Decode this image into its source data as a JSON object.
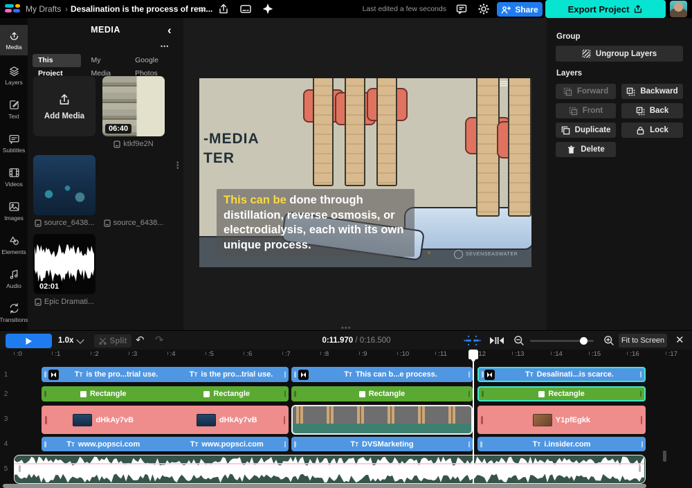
{
  "topbar": {
    "breadcrumb": "My Drafts",
    "crumb_separator": "›",
    "title": "Desalination is the process of rem...",
    "last_edited": "Last edited a few seconds ago",
    "share_label": "Share",
    "export_label": "Export Project"
  },
  "sidebar": {
    "items": [
      {
        "label": "Media"
      },
      {
        "label": "Layers"
      },
      {
        "label": "Text"
      },
      {
        "label": "Subtitles"
      },
      {
        "label": "Videos"
      },
      {
        "label": "Images"
      },
      {
        "label": "Elements"
      },
      {
        "label": "Audio"
      },
      {
        "label": "Transitions"
      }
    ]
  },
  "media_panel": {
    "title": "MEDIA",
    "menu_dots": "•••",
    "tabs": [
      {
        "label": "This Project"
      },
      {
        "label": "My Media"
      },
      {
        "label": "Google Photos"
      }
    ],
    "add_media_label": "Add Media",
    "items": [
      {
        "name": "ktkf9e2N",
        "duration": "06:40"
      },
      {
        "name": "source_6438..."
      },
      {
        "name": "source_6438..."
      },
      {
        "name": "Epic Dramati...",
        "duration": "02:01"
      }
    ]
  },
  "preview": {
    "caption_highlight": "This can be",
    "caption_rest": " done through distillation, reverse osmosis, or electrodialysis, each with its own unique process.",
    "scene_text_line1": "-MEDIA",
    "scene_text_line2": "TER",
    "watermark": "SEVENSEASWATER"
  },
  "right_panel": {
    "group_label": "Group",
    "ungroup_label": "Ungroup Layers",
    "layers_label": "Layers",
    "forward": "Forward",
    "backward": "Backward",
    "front": "Front",
    "back": "Back",
    "duplicate": "Duplicate",
    "lock": "Lock",
    "delete": "Delete"
  },
  "transport": {
    "speed": "1.0x",
    "split_label": "Split",
    "time_current": "0:11.970",
    "time_separator": " / ",
    "time_total": "0:16.500",
    "fit_label": "Fit to Screen"
  },
  "timeline": {
    "ruler": [
      ":0",
      ":1",
      ":2",
      ":3",
      ":4",
      ":5",
      ":6",
      ":7",
      ":8",
      ":9",
      ":10",
      ":11",
      ":12",
      ":13",
      ":14",
      ":15",
      ":16",
      ":17"
    ],
    "rows": [
      "1",
      "2",
      "3",
      "4",
      "5"
    ],
    "track1": {
      "clip1_label_a": "is the pro...trial use.",
      "clip1_label_b": "is the pro...trial use.",
      "clip2_label": "This can b...e process.",
      "clip3_label": "Desalinati...is scarce."
    },
    "track2": {
      "clip1_label_a": "Rectangle",
      "clip1_label_b": "Rectangle",
      "clip2_label": "Rectangle",
      "clip3_label": "Rectangle"
    },
    "track3": {
      "clip1_label_a": "dHkAy7vB",
      "clip1_label_b": "dHkAy7vB",
      "clip3_label": "Y1pfEgkk"
    },
    "track4": {
      "clip1_label_a": "www.popsci.com",
      "clip1_label_b": "www.popsci.com",
      "clip2_label": "DVSMarketing",
      "clip3_label": "i.insider.com"
    }
  },
  "colors": {
    "accent_blue": "#1f7cf0",
    "export_teal": "#07e4d1",
    "clip_blue": "#4f97e3",
    "clip_green": "#5aa933",
    "clip_pink": "#ef8c8c",
    "selection_teal": "#3fe8cd",
    "caption_highlight": "#ffd93b"
  }
}
